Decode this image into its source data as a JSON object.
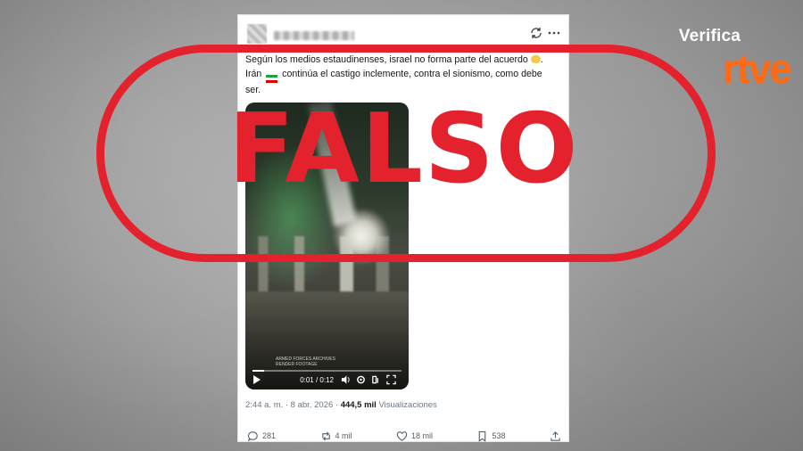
{
  "tweet": {
    "text_line1": "Según los medios estaudinenses, israel no forma parte del acuerdo",
    "text_line2": "Irán",
    "text_line2_rest": "continúa el castigo inclemente, contra el sionismo, como debe",
    "text_line3": "ser.",
    "video": {
      "watermark_line1": "ARMED FORCES ARCHIVES",
      "watermark_line2": "RENDER FOOTAGE",
      "time": "0:01 / 0:12",
      "progress": 0.08
    },
    "timestamp": "2:44 a. m. · 8 abr. 2026 ·",
    "views_count": "444,5 mil",
    "views_label": "Visualizaciones",
    "actions": {
      "replies": "281",
      "reposts": "4 mil",
      "likes": "18 mil",
      "bookmarks": "538"
    },
    "icons": [
      "translate-icon",
      "more-icon",
      "reply-icon",
      "repost-icon",
      "like-icon",
      "bookmark-icon",
      "share-icon",
      "play-icon",
      "volume-icon",
      "settings-icon",
      "fullscreen-icon",
      "expand-icon"
    ]
  },
  "overlay": {
    "label": "FALSO",
    "color": "#e3222d"
  },
  "brand": {
    "top": "Verifica",
    "logo": "rtve",
    "logo_color": "#ff6a13"
  }
}
